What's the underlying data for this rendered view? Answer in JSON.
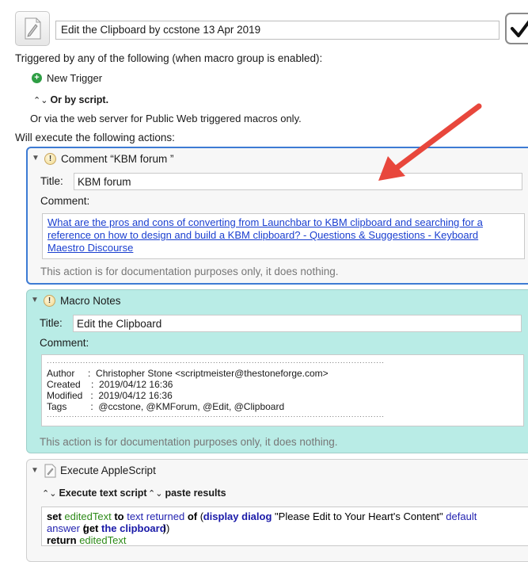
{
  "macro": {
    "name": "Edit the Clipboard by ccstone 13 Apr 2019",
    "enabled_icon": "checkmark-icon",
    "icon": "script-document-icon"
  },
  "triggers": {
    "heading": "Triggered by any of the following (when macro group is enabled):",
    "new_trigger_label": "New Trigger",
    "or_by_script": "Or by script.",
    "web_server_note": "Or via the web server for Public Web triggered macros only."
  },
  "actions_heading": "Will execute the following actions:",
  "actions": [
    {
      "title": "Comment “KBM forum ”",
      "field_title_label": "Title:",
      "field_title_value": "KBM forum",
      "comment_label": "Comment:",
      "comment_link_lines": [
        "What are the pros and cons of converting from Launchbar to KBM clipboard and searching for a",
        "reference on how to design and build a KBM clipboard? - Questions & Suggestions - Keyboard",
        "Maestro Discourse"
      ],
      "doc_note": "This action is for documentation purposes only, it does nothing."
    },
    {
      "title": "Macro Notes",
      "field_title_label": "Title:",
      "field_title_value": "Edit the Clipboard",
      "comment_label": "Comment:",
      "separator": "··························································································································",
      "notes_lines": [
        "Author     :  Christopher Stone <scriptmeister@thestoneforge.com>",
        "Created    :  2019/04/12 16:36",
        "Modified   :  2019/04/12 16:36",
        "Tags         :  @ccstone, @KMForum, @Edit, @Clipboard"
      ],
      "doc_note": "This action is for documentation purposes only, it does nothing."
    },
    {
      "title": "Execute AppleScript",
      "popup_1": "Execute text script",
      "popup_2": "paste results",
      "script": {
        "l1_set": "set",
        "l1_var": "editedText",
        "l1_to": "to",
        "l1_text_returned": "text returned",
        "l1_of": "of",
        "l1_open": "(",
        "l1_display_dialog": "display dialog",
        "l1_string": "\"Please Edit to Your Heart's Content\"",
        "l1_default": "default",
        "l2_answer": "answer",
        "l2_open": "(",
        "l2_get": "get",
        "l2_the_clipboard": "the clipboard",
        "l2_close": "))",
        "l3_return": "return",
        "l3_var": "editedText"
      }
    }
  ],
  "colors": {
    "selected_border": "#3d7bd4",
    "notes_bg": "#b9ece6",
    "arrow": "#e8473c",
    "link": "#1a3fd0"
  }
}
